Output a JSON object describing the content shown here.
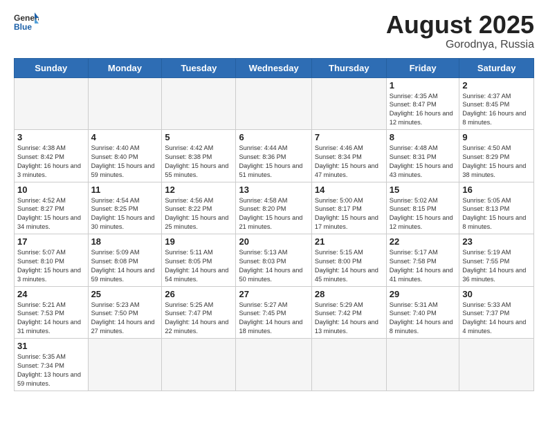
{
  "logo": {
    "general": "General",
    "blue": "Blue"
  },
  "title": "August 2025",
  "subtitle": "Gorodnya, Russia",
  "days_header": [
    "Sunday",
    "Monday",
    "Tuesday",
    "Wednesday",
    "Thursday",
    "Friday",
    "Saturday"
  ],
  "weeks": [
    [
      {
        "day": "",
        "info": ""
      },
      {
        "day": "",
        "info": ""
      },
      {
        "day": "",
        "info": ""
      },
      {
        "day": "",
        "info": ""
      },
      {
        "day": "",
        "info": ""
      },
      {
        "day": "1",
        "info": "Sunrise: 4:35 AM\nSunset: 8:47 PM\nDaylight: 16 hours and 12 minutes."
      },
      {
        "day": "2",
        "info": "Sunrise: 4:37 AM\nSunset: 8:45 PM\nDaylight: 16 hours and 8 minutes."
      }
    ],
    [
      {
        "day": "3",
        "info": "Sunrise: 4:38 AM\nSunset: 8:42 PM\nDaylight: 16 hours and 3 minutes."
      },
      {
        "day": "4",
        "info": "Sunrise: 4:40 AM\nSunset: 8:40 PM\nDaylight: 15 hours and 59 minutes."
      },
      {
        "day": "5",
        "info": "Sunrise: 4:42 AM\nSunset: 8:38 PM\nDaylight: 15 hours and 55 minutes."
      },
      {
        "day": "6",
        "info": "Sunrise: 4:44 AM\nSunset: 8:36 PM\nDaylight: 15 hours and 51 minutes."
      },
      {
        "day": "7",
        "info": "Sunrise: 4:46 AM\nSunset: 8:34 PM\nDaylight: 15 hours and 47 minutes."
      },
      {
        "day": "8",
        "info": "Sunrise: 4:48 AM\nSunset: 8:31 PM\nDaylight: 15 hours and 43 minutes."
      },
      {
        "day": "9",
        "info": "Sunrise: 4:50 AM\nSunset: 8:29 PM\nDaylight: 15 hours and 38 minutes."
      }
    ],
    [
      {
        "day": "10",
        "info": "Sunrise: 4:52 AM\nSunset: 8:27 PM\nDaylight: 15 hours and 34 minutes."
      },
      {
        "day": "11",
        "info": "Sunrise: 4:54 AM\nSunset: 8:25 PM\nDaylight: 15 hours and 30 minutes."
      },
      {
        "day": "12",
        "info": "Sunrise: 4:56 AM\nSunset: 8:22 PM\nDaylight: 15 hours and 25 minutes."
      },
      {
        "day": "13",
        "info": "Sunrise: 4:58 AM\nSunset: 8:20 PM\nDaylight: 15 hours and 21 minutes."
      },
      {
        "day": "14",
        "info": "Sunrise: 5:00 AM\nSunset: 8:17 PM\nDaylight: 15 hours and 17 minutes."
      },
      {
        "day": "15",
        "info": "Sunrise: 5:02 AM\nSunset: 8:15 PM\nDaylight: 15 hours and 12 minutes."
      },
      {
        "day": "16",
        "info": "Sunrise: 5:05 AM\nSunset: 8:13 PM\nDaylight: 15 hours and 8 minutes."
      }
    ],
    [
      {
        "day": "17",
        "info": "Sunrise: 5:07 AM\nSunset: 8:10 PM\nDaylight: 15 hours and 3 minutes."
      },
      {
        "day": "18",
        "info": "Sunrise: 5:09 AM\nSunset: 8:08 PM\nDaylight: 14 hours and 59 minutes."
      },
      {
        "day": "19",
        "info": "Sunrise: 5:11 AM\nSunset: 8:05 PM\nDaylight: 14 hours and 54 minutes."
      },
      {
        "day": "20",
        "info": "Sunrise: 5:13 AM\nSunset: 8:03 PM\nDaylight: 14 hours and 50 minutes."
      },
      {
        "day": "21",
        "info": "Sunrise: 5:15 AM\nSunset: 8:00 PM\nDaylight: 14 hours and 45 minutes."
      },
      {
        "day": "22",
        "info": "Sunrise: 5:17 AM\nSunset: 7:58 PM\nDaylight: 14 hours and 41 minutes."
      },
      {
        "day": "23",
        "info": "Sunrise: 5:19 AM\nSunset: 7:55 PM\nDaylight: 14 hours and 36 minutes."
      }
    ],
    [
      {
        "day": "24",
        "info": "Sunrise: 5:21 AM\nSunset: 7:53 PM\nDaylight: 14 hours and 31 minutes."
      },
      {
        "day": "25",
        "info": "Sunrise: 5:23 AM\nSunset: 7:50 PM\nDaylight: 14 hours and 27 minutes."
      },
      {
        "day": "26",
        "info": "Sunrise: 5:25 AM\nSunset: 7:47 PM\nDaylight: 14 hours and 22 minutes."
      },
      {
        "day": "27",
        "info": "Sunrise: 5:27 AM\nSunset: 7:45 PM\nDaylight: 14 hours and 18 minutes."
      },
      {
        "day": "28",
        "info": "Sunrise: 5:29 AM\nSunset: 7:42 PM\nDaylight: 14 hours and 13 minutes."
      },
      {
        "day": "29",
        "info": "Sunrise: 5:31 AM\nSunset: 7:40 PM\nDaylight: 14 hours and 8 minutes."
      },
      {
        "day": "30",
        "info": "Sunrise: 5:33 AM\nSunset: 7:37 PM\nDaylight: 14 hours and 4 minutes."
      }
    ],
    [
      {
        "day": "31",
        "info": "Sunrise: 5:35 AM\nSunset: 7:34 PM\nDaylight: 13 hours and 59 minutes."
      },
      {
        "day": "",
        "info": ""
      },
      {
        "day": "",
        "info": ""
      },
      {
        "day": "",
        "info": ""
      },
      {
        "day": "",
        "info": ""
      },
      {
        "day": "",
        "info": ""
      },
      {
        "day": "",
        "info": ""
      }
    ]
  ]
}
